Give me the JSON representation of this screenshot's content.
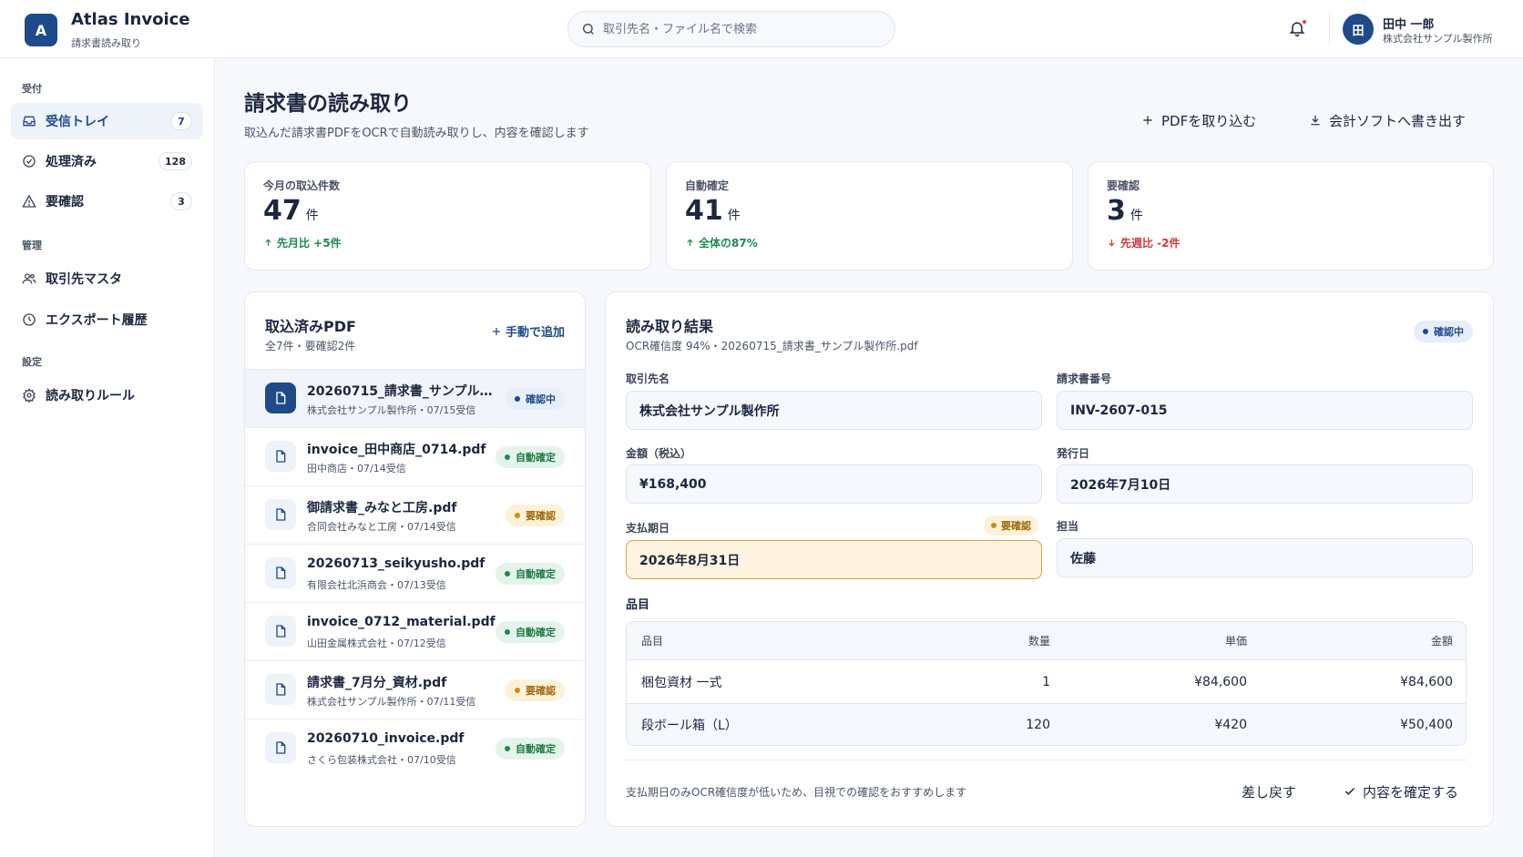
{
  "header": {
    "logo_letter": "A",
    "app_name": "Atlas Invoice",
    "app_sub": "請求書読み取り",
    "search_placeholder": "取引先名・ファイル名で検索",
    "user_initial": "田",
    "user_name": "田中 一郎",
    "user_org": "株式会社サンプル製作所"
  },
  "sidebar": {
    "sections": [
      "受付",
      "管理",
      "設定"
    ],
    "items": [
      {
        "label": "受信トレイ",
        "count": "7",
        "icon": "inbox-icon"
      },
      {
        "label": "処理済み",
        "count": "128",
        "icon": "check-circle-icon"
      },
      {
        "label": "要確認",
        "count": "3",
        "icon": "warning-icon"
      },
      {
        "label": "取引先マスタ",
        "icon": "users-icon"
      },
      {
        "label": "エクスポート履歴",
        "icon": "clock-icon"
      },
      {
        "label": "読み取りルール",
        "icon": "gear-icon"
      }
    ]
  },
  "page": {
    "title": "請求書の読み取り",
    "subtitle": "取込んだ請求書PDFをOCRで自動読み取りし、内容を確認します",
    "import_label": "PDFを取り込む",
    "export_label": "会計ソフトへ書き出す"
  },
  "stats": [
    {
      "label": "今月の取込件数",
      "value": "47",
      "unit": "件",
      "delta": "先月比 +5件",
      "trend": "up"
    },
    {
      "label": "自動確定",
      "value": "41",
      "unit": "件",
      "delta": "全体の87%",
      "trend": "up"
    },
    {
      "label": "要確認",
      "value": "3",
      "unit": "件",
      "delta": "先週比 -2件",
      "trend": "down"
    }
  ],
  "file_list": {
    "title": "取込済みPDF",
    "subtitle": "全7件・要確認2件",
    "add_label": "手動で追加",
    "files": [
      {
        "name": "20260715_請求書_サンプル製作所.pdf",
        "meta": "株式会社サンプル製作所・07/15受信",
        "status": "確認中"
      },
      {
        "name": "invoice_田中商店_0714.pdf",
        "meta": "田中商店・07/14受信",
        "status": "自動確定"
      },
      {
        "name": "御請求書_みなと工房.pdf",
        "meta": "合同会社みなと工房・07/14受信",
        "status": "要確認"
      },
      {
        "name": "20260713_seikyusho.pdf",
        "meta": "有限会社北浜商会・07/13受信",
        "status": "自動確定"
      },
      {
        "name": "invoice_0712_material.pdf",
        "meta": "山田金属株式会社・07/12受信",
        "status": "自動確定"
      },
      {
        "name": "請求書_7月分_資材.pdf",
        "meta": "株式会社サンプル製作所・07/11受信",
        "status": "要確認"
      },
      {
        "name": "20260710_invoice.pdf",
        "meta": "さくら包装株式会社・07/10受信",
        "status": "自動確定"
      }
    ]
  },
  "result": {
    "title": "読み取り結果",
    "subtitle": "OCR確信度 94%・20260715_請求書_サンプル製作所.pdf",
    "status": "確認中",
    "fields": {
      "vendor_label": "取引先名",
      "vendor": "株式会社サンプル製作所",
      "invoice_no_label": "請求書番号",
      "invoice_no": "INV-2607-015",
      "amount_label": "金額（税込）",
      "amount": "¥168,400",
      "issue_date_label": "発行日",
      "issue_date": "2026年7月10日",
      "due_date_label": "支払期日",
      "due_date": "2026年8月31日",
      "due_date_flag": "要確認",
      "owner_label": "担当",
      "owner": "佐藤"
    },
    "items_title": "品目",
    "table": {
      "headers": [
        "品目",
        "数量",
        "単価",
        "金額"
      ],
      "rows": [
        [
          "梱包資材 一式",
          "1",
          "¥84,600",
          "¥84,600"
        ],
        [
          "段ボール箱（L）",
          "120",
          "¥420",
          "¥50,400"
        ]
      ]
    },
    "note": "支払期日のみOCR確信度が低いため、目視での確認をおすすめします",
    "back_label": "差し戻す",
    "confirm_label": "内容を確定する"
  },
  "colors": {
    "primary": "#1f4a8a",
    "green": "#1e8a4e",
    "red": "#d13b3b",
    "amber": "#c8900f"
  }
}
